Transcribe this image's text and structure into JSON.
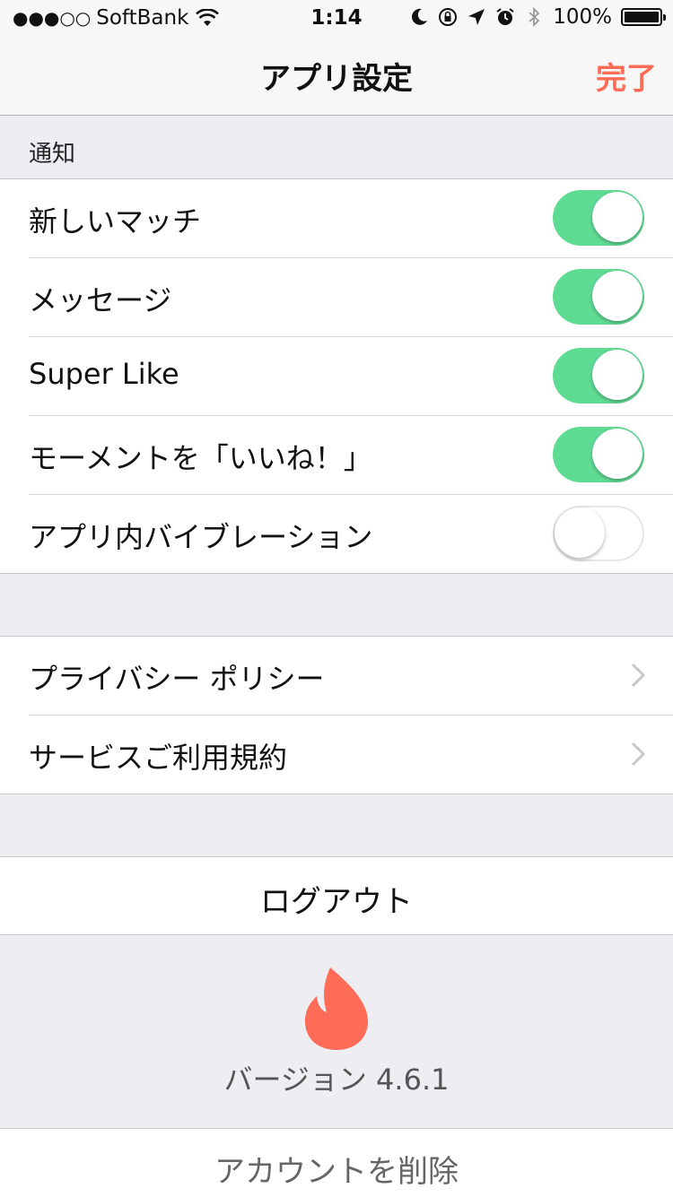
{
  "status_bar": {
    "signal": "●●●○○",
    "carrier": "SoftBank",
    "time": "1:14",
    "battery_percent": "100%"
  },
  "nav": {
    "title": "アプリ設定",
    "done_label": "完了",
    "accent_color": "#ff6b55"
  },
  "notifications": {
    "header": "通知",
    "items": [
      {
        "label": "新しいマッチ",
        "enabled": true
      },
      {
        "label": "メッセージ",
        "enabled": true
      },
      {
        "label": "Super Like",
        "enabled": true
      },
      {
        "label": "モーメントを「いいね！」",
        "enabled": true
      },
      {
        "label": "アプリ内バイブレーション",
        "enabled": false
      }
    ],
    "toggle_on_color": "#5fdc94"
  },
  "links": {
    "items": [
      {
        "label": "プライバシー ポリシー",
        "icon": "chevron-right-icon"
      },
      {
        "label": "サービスご利用規約",
        "icon": "chevron-right-icon"
      }
    ]
  },
  "logout": {
    "label": "ログアウト"
  },
  "footer": {
    "logo_icon": "flame-icon",
    "version": "バージョン 4.6.1"
  },
  "delete_account": {
    "label": "アカウントを削除"
  }
}
